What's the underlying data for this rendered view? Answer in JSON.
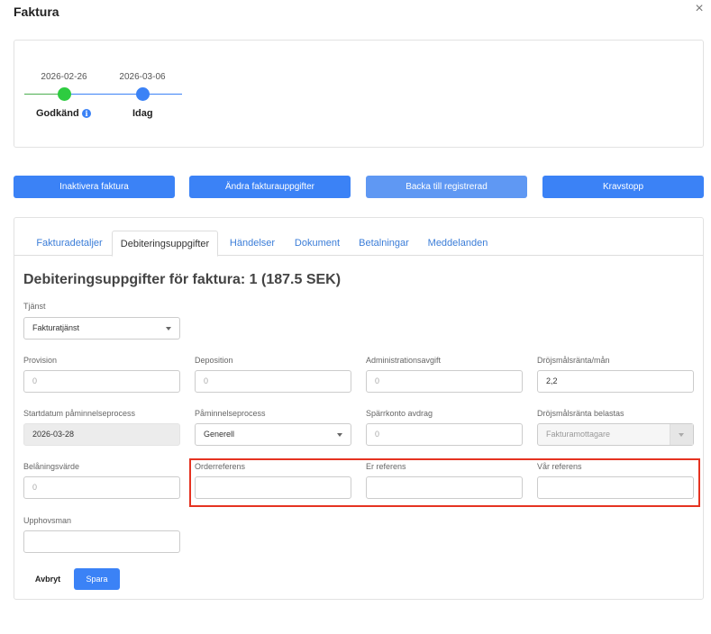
{
  "modal": {
    "title": "Faktura",
    "close_symbol": "×"
  },
  "timeline": {
    "steps": [
      {
        "date": "2026-02-26",
        "label": "Godkänd",
        "color": "#2ecc40",
        "has_info": true,
        "info_symbol": "i"
      },
      {
        "date": "2026-03-06",
        "label": "Idag",
        "color": "#3b82f6"
      }
    ]
  },
  "actions": [
    {
      "label": "Inaktivera faktura"
    },
    {
      "label": "Ändra fakturauppgifter"
    },
    {
      "label": "Backa till registrerad"
    },
    {
      "label": "Kravstopp"
    }
  ],
  "tabs": [
    {
      "label": "Fakturadetaljer",
      "active": false
    },
    {
      "label": "Debiteringsuppgifter",
      "active": true
    },
    {
      "label": "Händelser",
      "active": false
    },
    {
      "label": "Dokument",
      "active": false
    },
    {
      "label": "Betalningar",
      "active": false
    },
    {
      "label": "Meddelanden",
      "active": false
    }
  ],
  "form": {
    "title": "Debiteringsuppgifter för faktura: 1 (187.5 SEK)",
    "tjanst": {
      "label": "Tjänst",
      "value": "Fakturatjänst"
    },
    "provision": {
      "label": "Provision",
      "placeholder": "0"
    },
    "deposition": {
      "label": "Deposition",
      "placeholder": "0"
    },
    "administrationsavgift": {
      "label": "Administrationsavgift",
      "placeholder": "0"
    },
    "drojsmalsranta": {
      "label": "Dröjsmålsränta/mån",
      "value": "2,2"
    },
    "startdatum": {
      "label": "Startdatum påminnelseprocess",
      "value": "2026-03-28"
    },
    "paminnelseprocess": {
      "label": "Påminnelseprocess",
      "value": "Generell"
    },
    "sparrkonto": {
      "label": "Spärrkonto avdrag",
      "placeholder": "0"
    },
    "drojsmal_belastas": {
      "label": "Dröjsmålsränta belastas",
      "value": "Fakturamottagare"
    },
    "belaningsvarde": {
      "label": "Belåningsvärde",
      "placeholder": "0"
    },
    "orderreferens": {
      "label": "Orderreferens",
      "value": ""
    },
    "er_referens": {
      "label": "Er referens",
      "value": ""
    },
    "var_referens": {
      "label": "Vår referens",
      "value": ""
    },
    "upphovsman": {
      "label": "Upphovsman",
      "value": ""
    },
    "cancel_label": "Avbryt",
    "save_label": "Spara"
  },
  "colors": {
    "primary": "#3b82f6",
    "highlight": "#e53321",
    "success": "#2ecc40"
  }
}
